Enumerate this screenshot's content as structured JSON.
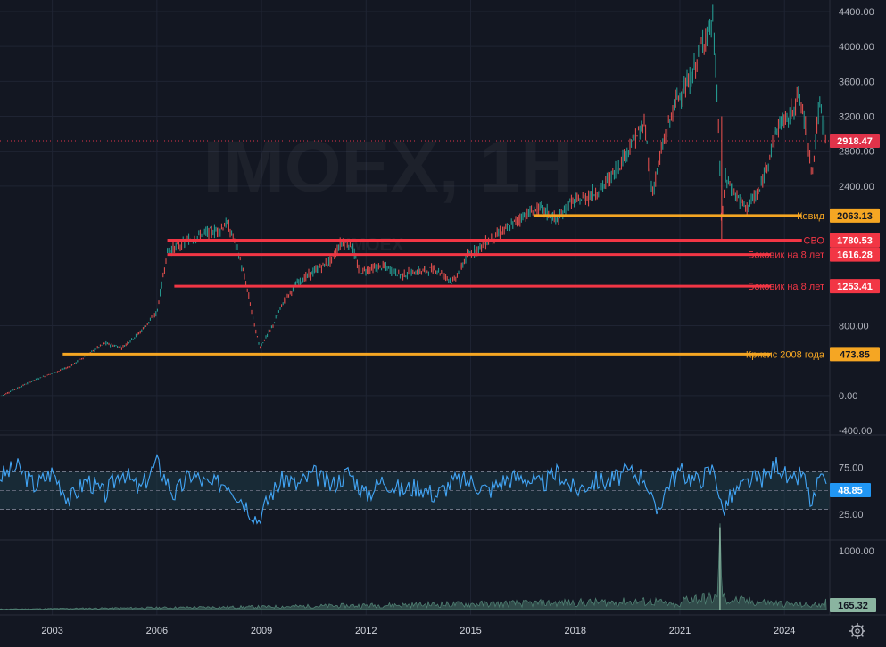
{
  "symbol_watermark": "IMOEX, 1H",
  "symbol_watermark_small": "IMOEX",
  "colors": {
    "background": "#131722",
    "grid": "#1f2433",
    "candle_up": "#26a69a",
    "candle_down": "#ef5350",
    "level_orange": "#f5a623",
    "level_red": "#f23645",
    "rsi_line": "#42a5f5",
    "rsi_band": "#1d3a47",
    "volume": "#4f7f72",
    "axis_text": "#b2b5be",
    "last_price_tag": "#e0334a",
    "volume_tag": "#8ab4a0"
  },
  "price_axis": {
    "ticks": [
      "4400.00",
      "4000.00",
      "3600.00",
      "3200.00",
      "2800.00",
      "2400.00",
      "800.00",
      "0.00",
      "-400.00"
    ]
  },
  "rsi_axis": {
    "ticks": [
      "75.00",
      "25.00"
    ],
    "value_tag": "48.85"
  },
  "volume_axis": {
    "ticks": [
      "1000.00"
    ],
    "value_tag": "165.32"
  },
  "x_axis": {
    "ticks": [
      "2003",
      "2006",
      "2009",
      "2012",
      "2015",
      "2018",
      "2021",
      "2024"
    ]
  },
  "last_price": "2918.47",
  "levels": [
    {
      "price": "2063.13",
      "label": "Ковид",
      "color": "orange"
    },
    {
      "price": "1780.53",
      "label": "СВО",
      "color": "red"
    },
    {
      "price": "1616.28",
      "label": "Боковик на 8 лет",
      "color": "red"
    },
    {
      "price": "1253.41",
      "label": "Боковик на 8 лет",
      "color": "red"
    },
    {
      "price": "473.85",
      "label": "Кризис 2008 года",
      "color": "orange"
    }
  ],
  "chart_data": {
    "type": "line",
    "title": "IMOEX, 1H",
    "price_series": {
      "x": [
        2001.5,
        2002.5,
        2003.5,
        2004.5,
        2005.0,
        2005.5,
        2006.0,
        2006.3,
        2006.8,
        2007.3,
        2007.8,
        2008.0,
        2008.3,
        2008.6,
        2008.8,
        2008.95,
        2009.3,
        2009.6,
        2010.0,
        2010.5,
        2011.0,
        2011.3,
        2011.6,
        2011.8,
        2012.1,
        2012.5,
        2013.0,
        2013.5,
        2014.0,
        2014.5,
        2014.9,
        2015.2,
        2015.6,
        2016.0,
        2016.5,
        2017.0,
        2017.5,
        2017.8,
        2018.2,
        2018.7,
        2019.2,
        2019.7,
        2020.0,
        2020.2,
        2020.5,
        2020.9,
        2021.3,
        2021.7,
        2021.95,
        2022.1,
        2022.2,
        2022.3,
        2022.6,
        2022.9,
        2023.3,
        2023.7,
        2023.9,
        2024.1,
        2024.4,
        2024.6,
        2024.8,
        2025.0,
        2025.2
      ],
      "y": [
        -10,
        180,
        330,
        600,
        550,
        720,
        950,
        1650,
        1750,
        1850,
        1900,
        1980,
        1700,
        1200,
        800,
        550,
        780,
        1050,
        1280,
        1420,
        1550,
        1760,
        1720,
        1420,
        1450,
        1480,
        1380,
        1420,
        1450,
        1300,
        1600,
        1680,
        1800,
        1900,
        2060,
        2150,
        2000,
        2200,
        2250,
        2350,
        2600,
        2950,
        3100,
        2300,
        2850,
        3400,
        3600,
        4100,
        4280,
        3200,
        1900,
        2500,
        2300,
        2150,
        2350,
        2950,
        3150,
        3150,
        3450,
        3100,
        2550,
        3350,
        2918
      ]
    },
    "rsi_series": {
      "x": [
        2001.5,
        2002.0,
        2002.5,
        2003.0,
        2003.5,
        2004.0,
        2004.5,
        2005.0,
        2005.5,
        2006.0,
        2006.5,
        2007.0,
        2007.5,
        2008.0,
        2008.5,
        2008.9,
        2009.3,
        2009.7,
        2010.0,
        2010.5,
        2011.0,
        2011.5,
        2012.0,
        2012.5,
        2013.0,
        2013.5,
        2014.0,
        2014.5,
        2015.0,
        2015.5,
        2016.0,
        2016.5,
        2017.0,
        2017.5,
        2018.0,
        2018.5,
        2019.0,
        2019.5,
        2020.0,
        2020.3,
        2020.7,
        2021.0,
        2021.5,
        2022.0,
        2022.2,
        2022.5,
        2023.0,
        2023.5,
        2023.8,
        2024.2,
        2024.5,
        2024.8,
        2025.0,
        2025.2
      ],
      "y": [
        65,
        75,
        55,
        70,
        40,
        62,
        45,
        72,
        50,
        80,
        45,
        68,
        55,
        60,
        38,
        18,
        48,
        65,
        55,
        68,
        55,
        70,
        45,
        62,
        50,
        55,
        45,
        60,
        60,
        50,
        62,
        65,
        55,
        70,
        50,
        60,
        60,
        70,
        65,
        25,
        60,
        70,
        60,
        75,
        28,
        45,
        60,
        65,
        80,
        55,
        70,
        32,
        65,
        48.85
      ]
    },
    "volume_series": {
      "x": [
        2001.5,
        2008.9,
        2020.3,
        2021.0,
        2022.15,
        2022.3,
        2024.8,
        2025.2
      ],
      "y": [
        10,
        60,
        180,
        70,
        1400,
        220,
        90,
        165.32
      ]
    },
    "price_axis_range": [
      -400,
      4400
    ],
    "rsi_axis_range": [
      0,
      100
    ],
    "rsi_bands": [
      30,
      70
    ],
    "x_range": [
      2001.5,
      2025.3
    ],
    "grid": true
  }
}
